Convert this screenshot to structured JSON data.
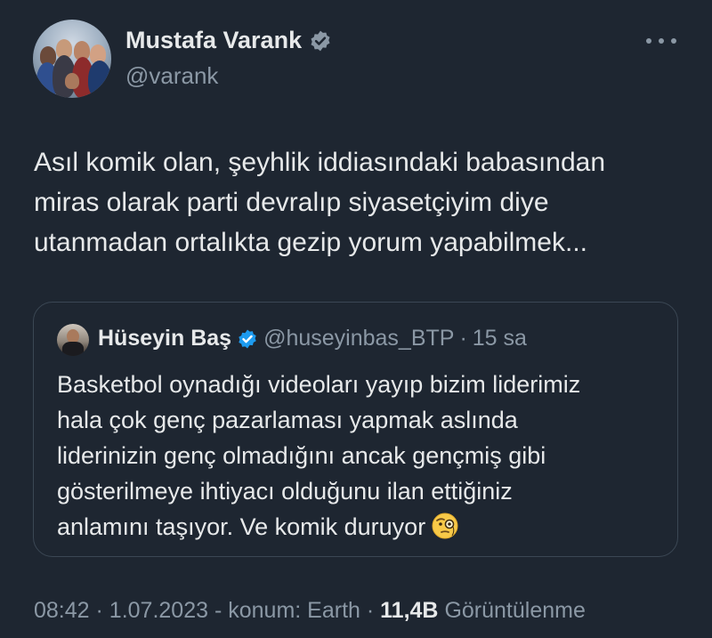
{
  "author": {
    "display_name": "Mustafa Varank",
    "handle": "@varank",
    "verified_color": "#8b98a5"
  },
  "tweet": {
    "lines": [
      "Asıl komik olan, şeyhlik iddiasındaki babasından",
      "miras olarak parti devralıp siyasetçiyim diye",
      "utanmadan ortalıkta gezip yorum yapabilmek..."
    ]
  },
  "quoted": {
    "display_name": "Hüseyin Baş",
    "handle": "@huseyinbas_BTP",
    "separator": "·",
    "time": "15 sa",
    "verified_color": "#1d9bf0",
    "lines": [
      "Basketbol oynadığı videoları yayıp bizim liderimiz",
      "hala çok genç pazarlaması yapmak aslında",
      "liderinizin genç olmadığını ancak gençmiş gibi",
      "gösterilmeye ihtiyacı olduğunu ilan ettiğiniz",
      "anlamını taşıyor. Ve komik duruyor"
    ],
    "emoji": "face-with-monocle"
  },
  "meta": {
    "time": "08:42",
    "dot1": "·",
    "date": "1.07.2023",
    "location": "- konum: Earth",
    "dot2": "·",
    "views_count": "11,4B",
    "views_label": "Görüntülenme"
  },
  "colors": {
    "background": "#1e2631",
    "text": "#e7e9ea",
    "secondary": "#8b98a5",
    "border": "#3b4754"
  }
}
